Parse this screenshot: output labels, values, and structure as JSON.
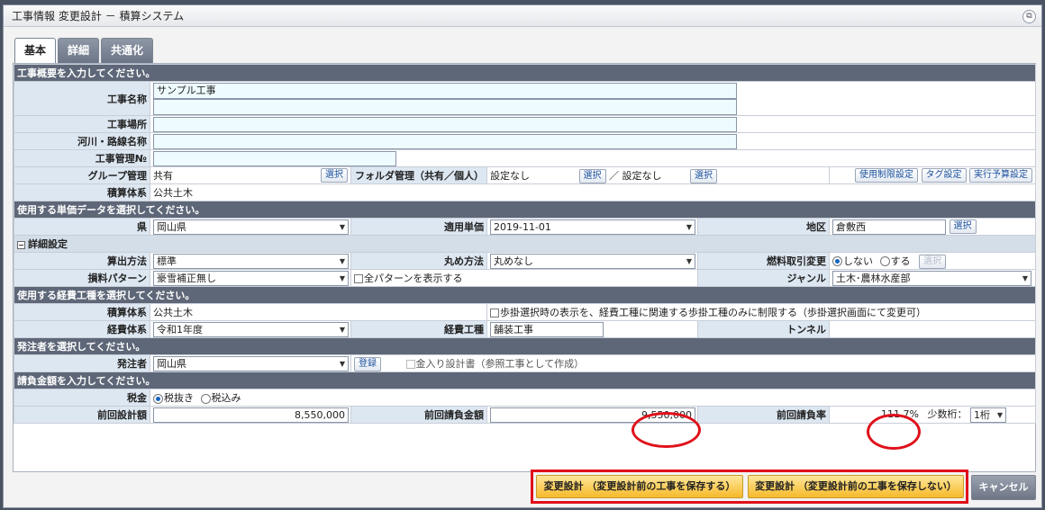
{
  "window": {
    "title": "工事情報 変更設計 － 積算システム"
  },
  "tabs": [
    "基本",
    "詳細",
    "共通化"
  ],
  "sections": {
    "overview": "工事概要を入力してください。",
    "unit_data": "使用する単価データを選択してください。",
    "detail": "詳細設定",
    "expense": "使用する経費工種を選択してください。",
    "orderer": "発注者を選択してください。",
    "contract": "請負金額を入力してください。"
  },
  "overview": {
    "name_label": "工事名称",
    "name_value": "サンプル工事",
    "place_label": "工事場所",
    "river_label": "河川・路線名称",
    "mgmt_no_label": "工事管理№",
    "group_label": "グループ管理",
    "group_value": "共有",
    "select_label": "選択",
    "folder_label": "フォルダ管理（共有／個人）",
    "folder_value1": "設定なし",
    "folder_sep": "／",
    "folder_value2": "設定なし",
    "use_limit_button": "使用制限設定",
    "tag_button": "タグ設定",
    "exec_budget_button": "実行予算設定",
    "estimate_label": "積算体系",
    "estimate_value": "公共土木"
  },
  "unit": {
    "pref_label": "県",
    "pref_value": "岡山県",
    "apply_label": "適用単価",
    "apply_value": "2019-11-01",
    "area_label": "地区",
    "area_value": "倉敷西"
  },
  "detail": {
    "calc_label": "算出方法",
    "calc_value": "標準",
    "round_label": "丸め方法",
    "round_value": "丸めなし",
    "fuel_label": "燃料取引変更",
    "fuel_no": "しない",
    "fuel_yes": "する",
    "loss_label": "損料パターン",
    "loss_value": "豪雪補正無し",
    "show_all_label": "全パターンを表示する",
    "genre_label": "ジャンル",
    "genre_value": "土木･農林水産部"
  },
  "expense": {
    "estimate_label": "積算体系",
    "estimate_value": "公共土木",
    "step_option": "歩掛選択時の表示を、経費工種に関連する歩掛工種のみに制限する（歩掛選択画面にて変更可）",
    "system_label": "経費体系",
    "system_value": "令和1年度",
    "kind_label": "経費工種",
    "kind_value": "舗装工事",
    "tunnel_label": "トンネル"
  },
  "orderer": {
    "label": "発注者",
    "value": "岡山県",
    "register_button": "登録",
    "priced_doc": "金入り設計書（参照工事として作成）"
  },
  "contract": {
    "tax_label": "税金",
    "tax_excl": "税抜き",
    "tax_incl": "税込み",
    "prev_design_label": "前回設計額",
    "prev_design_value": "8,550,000",
    "prev_contract_label": "前回請負金額",
    "prev_contract_value": "9,550,000",
    "prev_rate_label": "前回請負率",
    "prev_rate_value": "111.7",
    "rate_unit": "%",
    "decimal_label": "少数桁：",
    "decimal_value": "1桁"
  },
  "footer": {
    "save_button": "変更設計 （変更設計前の工事を保存する）",
    "nosave_button": "変更設計 （変更設計前の工事を保存しない）",
    "cancel_button": "キャンセル"
  },
  "colors": {
    "section_bg": "#5e6778",
    "label_bg": "#dde7f1",
    "highlight": "#e0101a",
    "accent_button": "#f6b92a"
  }
}
